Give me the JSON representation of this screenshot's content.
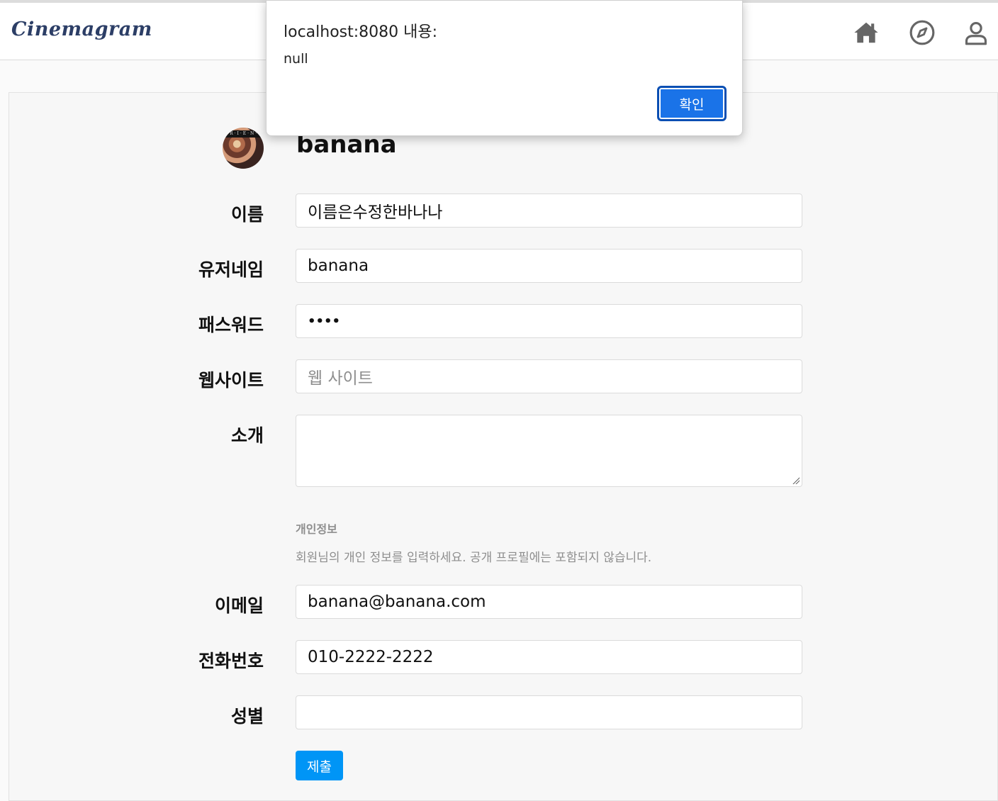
{
  "app": {
    "logo": "Cinemagram"
  },
  "nav": {
    "icons": [
      "home-icon",
      "explore-compass-icon",
      "profile-user-icon"
    ]
  },
  "profile": {
    "username": "banana"
  },
  "form": {
    "name_label": "이름",
    "name_value": "이름은수정한바나나",
    "username_label": "유저네임",
    "username_value": "banana",
    "password_label": "패스워드",
    "password_value": "••••",
    "website_label": "웹사이트",
    "website_placeholder": "웹 사이트",
    "bio_label": "소개",
    "bio_value": "",
    "private_title": "개인정보",
    "private_desc": "회원님의 개인 정보를 입력하세요. 공개 프로필에는 포함되지 않습니다.",
    "email_label": "이메일",
    "email_value": "banana@banana.com",
    "phone_label": "전화번호",
    "phone_value": "010-2222-2222",
    "gender_label": "성별",
    "gender_value": "",
    "submit_label": "제출"
  },
  "dialog": {
    "title": "localhost:8080 내용:",
    "message": "null",
    "ok_label": "확인"
  },
  "colors": {
    "accent": "#0095f6",
    "dialog_button": "#1a73e8",
    "logo": "#2c3e66"
  }
}
